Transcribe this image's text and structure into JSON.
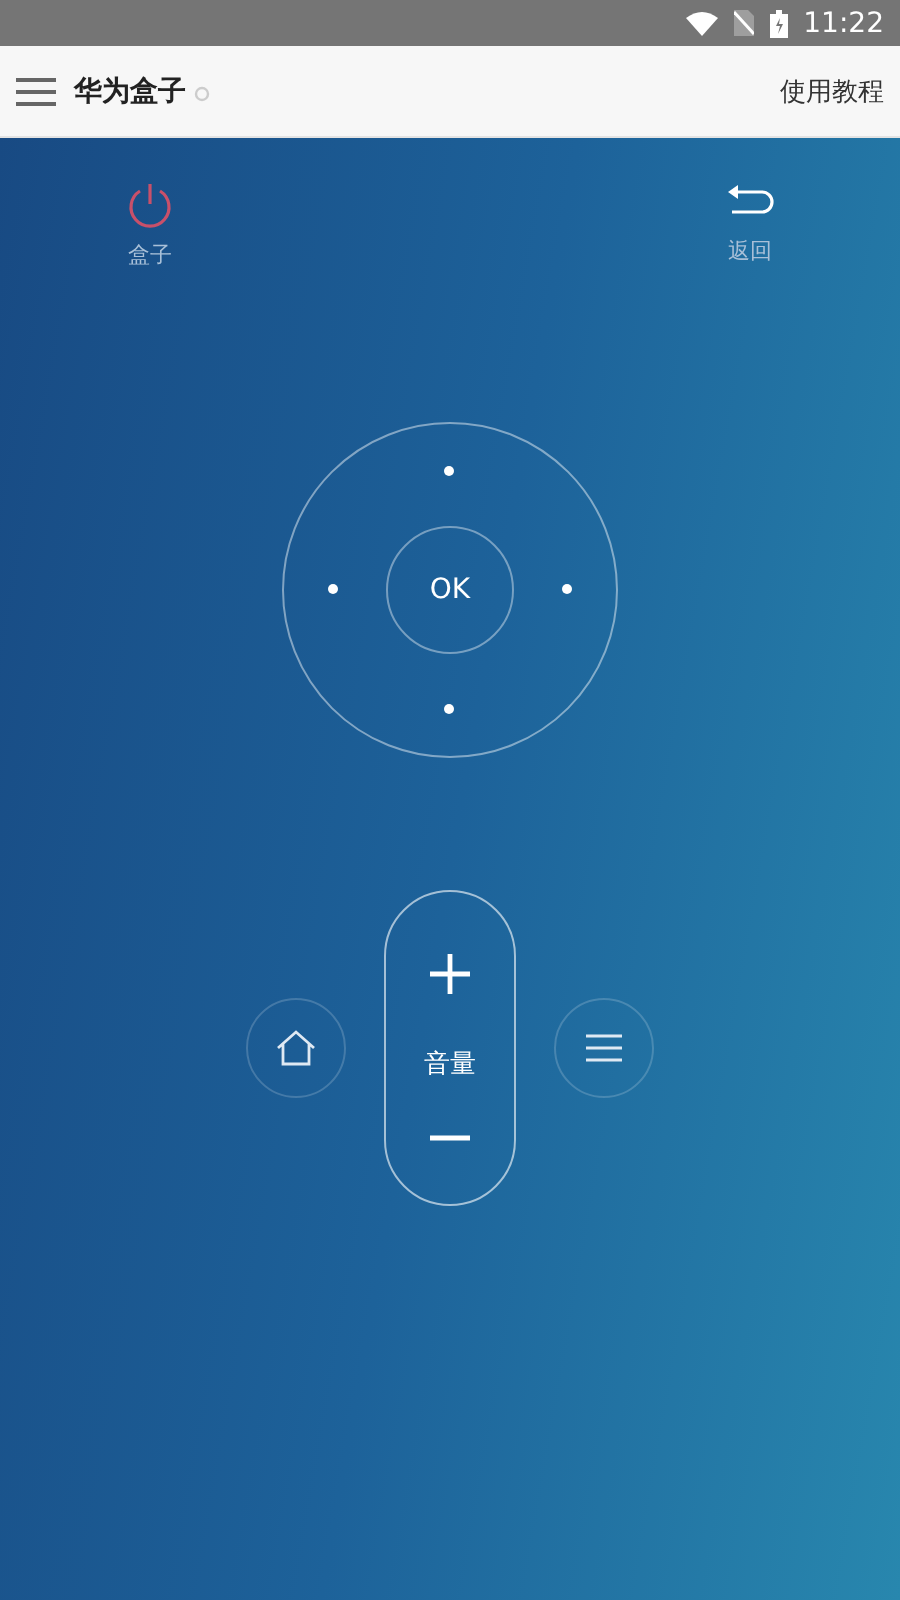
{
  "status_bar": {
    "time": "11:22"
  },
  "app_bar": {
    "title": "华为盒子",
    "action": "使用教程"
  },
  "top_buttons": [
    {
      "kind": "power",
      "label": "盒子"
    },
    {
      "kind": "back",
      "label": "返回"
    }
  ],
  "dpad": {
    "center": "OK"
  },
  "volume": {
    "label": "音量"
  }
}
